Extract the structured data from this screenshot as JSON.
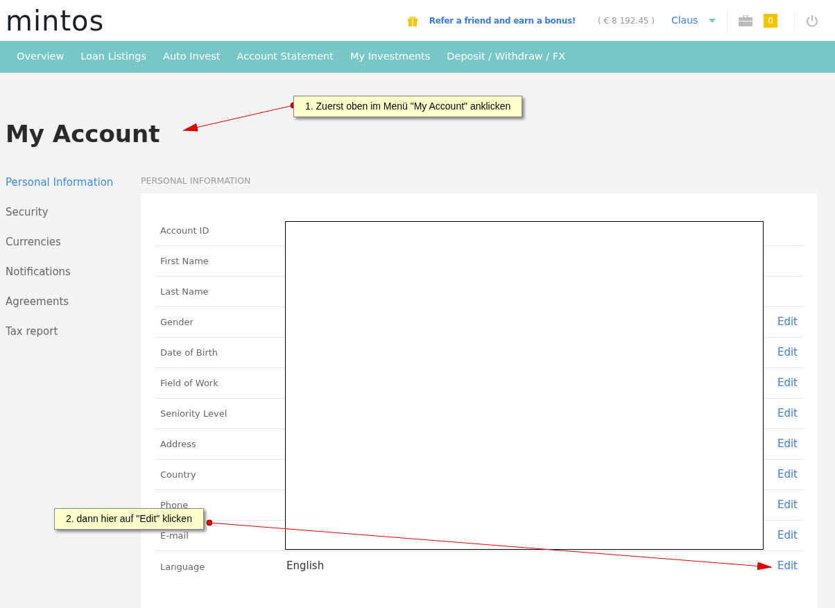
{
  "logo": "mintos",
  "header": {
    "referral": "Refer a friend and earn a bonus!",
    "balance": "( € 8 192.45 )",
    "user": "Claus",
    "notifications": "0"
  },
  "nav": [
    {
      "label": "Overview"
    },
    {
      "label": "Loan Listings"
    },
    {
      "label": "Auto Invest"
    },
    {
      "label": "Account Statement"
    },
    {
      "label": "My Investments"
    },
    {
      "label": "Deposit / Withdraw / FX"
    }
  ],
  "title": "My Account",
  "sidebar": [
    {
      "label": "Personal Information",
      "selected": true
    },
    {
      "label": "Security",
      "selected": false
    },
    {
      "label": "Currencies",
      "selected": false
    },
    {
      "label": "Notifications",
      "selected": false
    },
    {
      "label": "Agreements",
      "selected": false
    },
    {
      "label": "Tax report",
      "selected": false
    }
  ],
  "section_title": "PERSONAL INFORMATION",
  "rows": [
    {
      "label": "Account ID"
    },
    {
      "label": "First Name"
    },
    {
      "label": "Last Name"
    },
    {
      "label": "Gender",
      "action": "Edit"
    },
    {
      "label": "Date of Birth",
      "action": "Edit"
    },
    {
      "label": "Field of Work",
      "action": "Edit"
    },
    {
      "label": "Seniority Level",
      "action": "Edit"
    },
    {
      "label": "Address",
      "action": "Edit"
    },
    {
      "label": "Country",
      "action": "Edit"
    },
    {
      "label": "Phone",
      "action": "Edit"
    },
    {
      "label": "E-mail",
      "action": "Edit"
    },
    {
      "label": "Language",
      "value": "English",
      "action": "Edit"
    }
  ],
  "callouts": [
    {
      "text": "1. Zuerst oben im Menü \"My Account\" anklicken"
    },
    {
      "text": "2. dann hier auf \"Edit\" klicken"
    }
  ]
}
